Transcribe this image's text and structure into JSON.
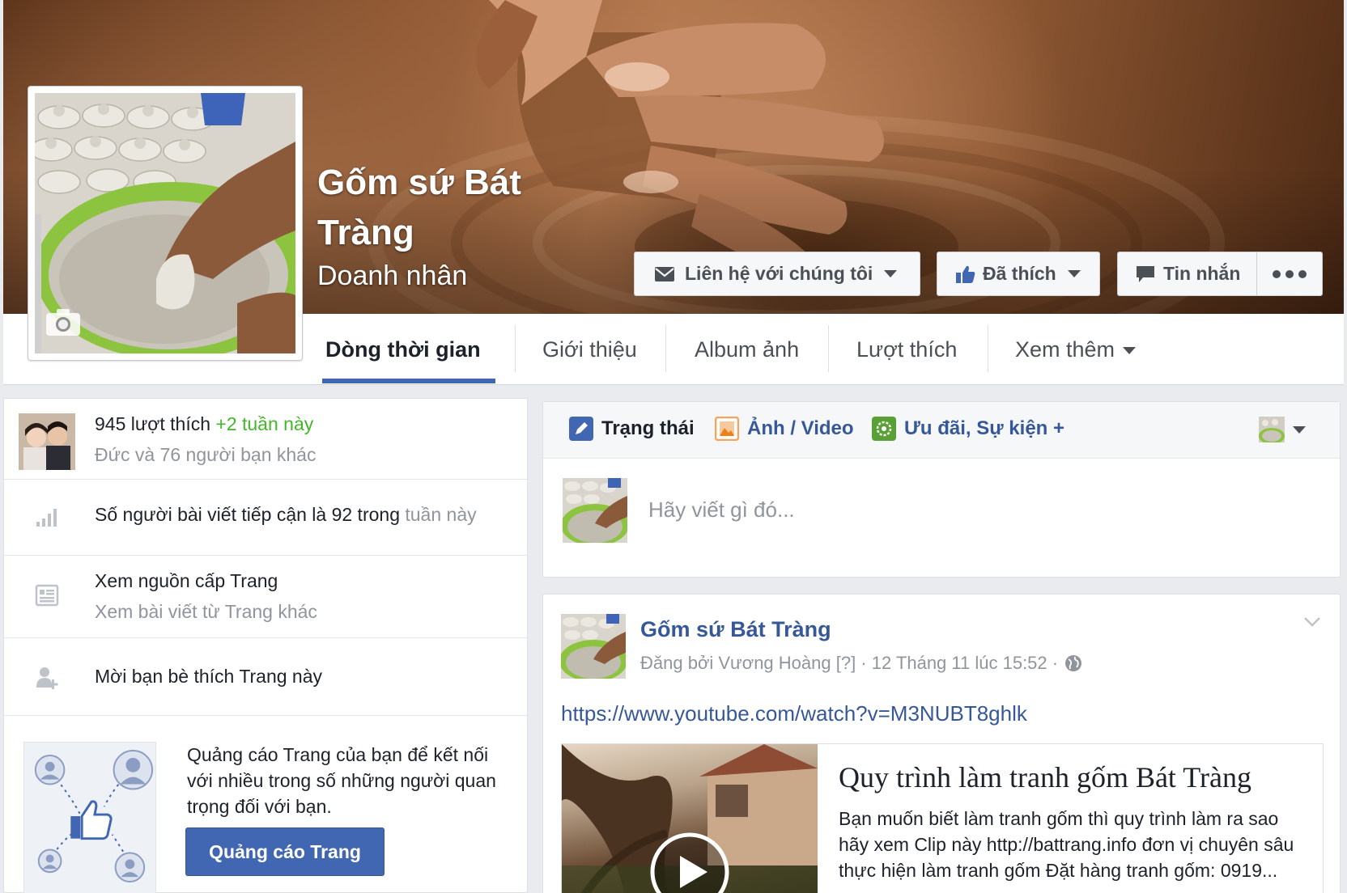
{
  "page": {
    "name": "Gốm sứ Bát Tràng",
    "category": "Doanh nhân"
  },
  "cover_actions": {
    "contact": "Liên hệ với chúng tôi",
    "liked": "Đã thích",
    "message": "Tin nhắn"
  },
  "nav": {
    "tabs": [
      "Dòng thời gian",
      "Giới thiệu",
      "Album ảnh",
      "Lượt thích",
      "Xem thêm"
    ],
    "active": "Dòng thời gian"
  },
  "sidebar": {
    "likes_count": "945 lượt thích",
    "likes_delta": "+2 tuần này",
    "friends_like": "Đức và 76 người bạn khác",
    "reach_text": "Số người bài viết tiếp cận là 92 trong",
    "reach_period": "tuần này",
    "feed_title": "Xem nguồn cấp Trang",
    "feed_sub": "Xem bài viết từ Trang khác",
    "invite": "Mời bạn bè thích Trang này",
    "ad_text": "Quảng cáo Trang của bạn để kết nối với nhiều trong số những người quan trọng đối với bạn.",
    "ad_button": "Quảng cáo Trang"
  },
  "composer": {
    "tabs": [
      "Trạng thái",
      "Ảnh / Video",
      "Ưu đãi, Sự kiện +"
    ],
    "placeholder": "Hãy viết gì đó..."
  },
  "post": {
    "author": "Gốm sứ Bát Tràng",
    "meta": "Đăng bởi Vương Hoàng [?] · 12 Tháng 11 lúc 15:52 ·",
    "link": "https://www.youtube.com/watch?v=M3NUBT8ghlk",
    "attachment_title": "Quy trình làm tranh gốm Bát Tràng",
    "attachment_desc": "Bạn muốn biết làm tranh gốm thì quy trình làm ra sao hãy xem Clip này http://battrang.info đơn vị chuyên sâu thực hiện làm tranh gốm Đặt hàng tranh gốm: 0919..."
  },
  "colors": {
    "brand_blue": "#4267b2",
    "link_blue": "#365899",
    "green": "#42b72a"
  }
}
